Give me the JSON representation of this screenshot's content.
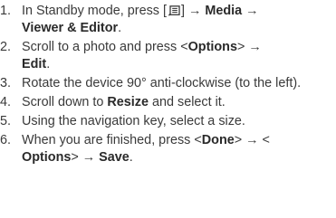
{
  "steps": [
    {
      "num": "1.",
      "p1": "In Standby mode, press [",
      "icon": "menu-key-icon",
      "p2": "] → ",
      "b1": "Media",
      "p3": " → ",
      "b2": "Viewer & Editor",
      "p4": "."
    },
    {
      "num": "2.",
      "p1": "Scroll to a photo and press <",
      "b1": "Options",
      "p2": "> → ",
      "b2": "Edit",
      "p3": "."
    },
    {
      "num": "3.",
      "text": "Rotate the device 90° anti-clockwise (to the left)."
    },
    {
      "num": "4.",
      "p1": "Scroll down to ",
      "b1": "Resize",
      "p2": " and select it."
    },
    {
      "num": "5.",
      "text": "Using the navigation key, select a size."
    },
    {
      "num": "6.",
      "p1": "When you are finished, press <",
      "b1": "Done",
      "p2": "> → <",
      "b2": "Options",
      "p3": "> → ",
      "b3": "Save",
      "p4": "."
    }
  ]
}
